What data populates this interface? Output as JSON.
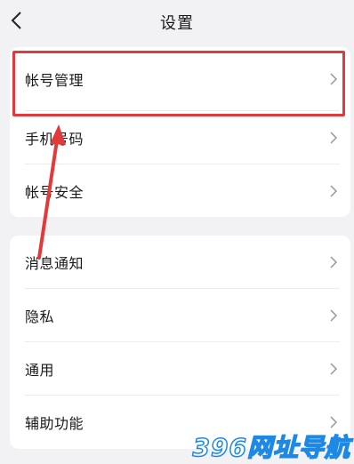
{
  "header": {
    "title": "设置",
    "back_icon": "chevron-left-icon"
  },
  "group1": {
    "items": [
      {
        "label": "帐号管理"
      },
      {
        "label": "手机号码"
      },
      {
        "label": "帐号安全"
      }
    ]
  },
  "group2": {
    "items": [
      {
        "label": "消息通知"
      },
      {
        "label": "隐私"
      },
      {
        "label": "通用"
      },
      {
        "label": "辅助功能"
      }
    ]
  },
  "annotation": {
    "highlight_color": "#e23a3a"
  },
  "watermark": {
    "text": "396网址导航"
  }
}
